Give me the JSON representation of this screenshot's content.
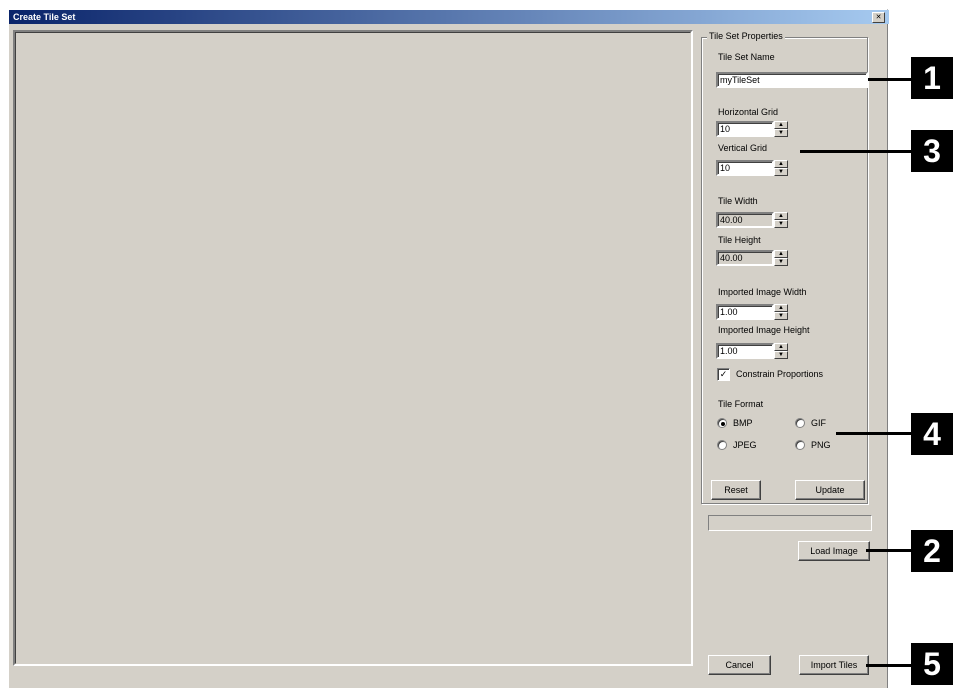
{
  "window": {
    "title": "Create Tile Set"
  },
  "properties": {
    "group_title": "Tile Set Properties",
    "tile_set_name_label": "Tile Set Name",
    "tile_set_name_value": "myTileSet",
    "horizontal_grid_label": "Horizontal Grid",
    "horizontal_grid_value": "10",
    "vertical_grid_label": "Vertical Grid",
    "vertical_grid_value": "10",
    "tile_width_label": "Tile Width",
    "tile_width_value": "40.00",
    "tile_height_label": "Tile Height",
    "tile_height_value": "40.00",
    "imported_width_label": "Imported Image Width",
    "imported_width_value": "1.00",
    "imported_height_label": "Imported Image Height",
    "imported_height_value": "1.00",
    "constrain_label": "Constrain Proportions",
    "constrain_checked": true,
    "tile_format_label": "Tile Format",
    "formats": [
      "BMP",
      "GIF",
      "JPEG",
      "PNG"
    ],
    "selected_format": "BMP"
  },
  "buttons": {
    "reset": "Reset",
    "update": "Update",
    "load_image": "Load Image",
    "cancel": "Cancel",
    "import_tiles": "Import Tiles"
  },
  "callouts": [
    "1",
    "3",
    "4",
    "2",
    "5"
  ]
}
